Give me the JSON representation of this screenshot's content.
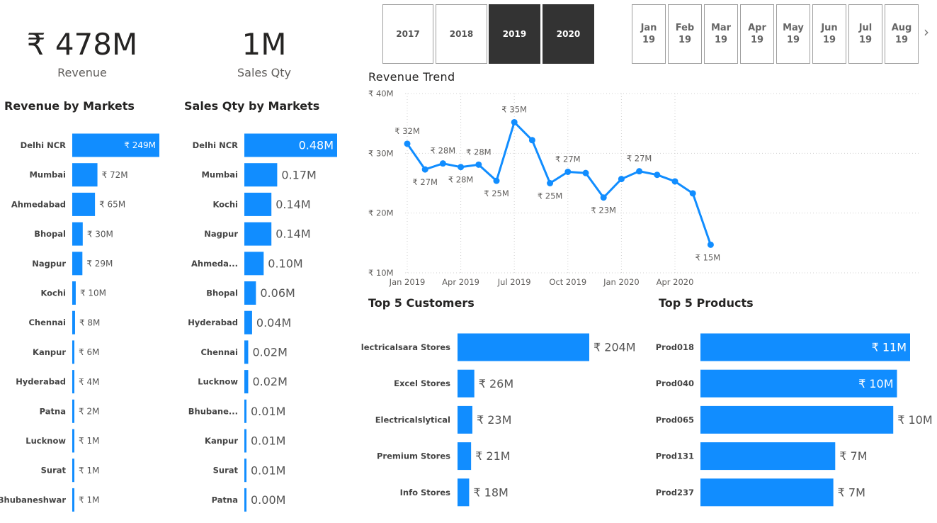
{
  "kpis": {
    "revenue": {
      "value": "₹ 478M",
      "label": "Revenue"
    },
    "sales_qty": {
      "value": "1M",
      "label": "Sales Qty"
    }
  },
  "year_slicer": [
    {
      "label": "2017",
      "selected": false
    },
    {
      "label": "2018",
      "selected": false
    },
    {
      "label": "2019",
      "selected": true
    },
    {
      "label": "2020",
      "selected": true
    }
  ],
  "month_slicer": {
    "items": [
      {
        "month": "Jan",
        "year": "19"
      },
      {
        "month": "Feb",
        "year": "19"
      },
      {
        "month": "Mar",
        "year": "19"
      },
      {
        "month": "Apr",
        "year": "19"
      },
      {
        "month": "May",
        "year": "19"
      },
      {
        "month": "Jun",
        "year": "19"
      },
      {
        "month": "Jul",
        "year": "19"
      },
      {
        "month": "Aug",
        "year": "19"
      }
    ],
    "next_glyph": "›"
  },
  "colors": {
    "bar": "#118DFF",
    "selected": "#333333",
    "grid": "#d0d0d0"
  },
  "chart_data": [
    {
      "id": "revenue_by_markets",
      "type": "bar",
      "orientation": "horizontal",
      "title": "Revenue by Markets",
      "categories": [
        "Delhi NCR",
        "Mumbai",
        "Ahmedabad",
        "Bhopal",
        "Nagpur",
        "Kochi",
        "Chennai",
        "Kanpur",
        "Hyderabad",
        "Patna",
        "Lucknow",
        "Surat",
        "Bhubaneshwar"
      ],
      "values": [
        249,
        72,
        65,
        30,
        29,
        10,
        8,
        6,
        4,
        2,
        1,
        1,
        1
      ],
      "labels": [
        "₹ 249M",
        "₹ 72M",
        "₹ 65M",
        "₹ 30M",
        "₹ 29M",
        "₹ 10M",
        "₹ 8M",
        "₹ 6M",
        "₹ 4M",
        "₹ 2M",
        "₹ 1M",
        "₹ 1M",
        "₹ 1M"
      ],
      "unit": "M"
    },
    {
      "id": "sales_qty_by_markets",
      "type": "bar",
      "orientation": "horizontal",
      "title": "Sales Qty by Markets",
      "categories": [
        "Delhi NCR",
        "Mumbai",
        "Kochi",
        "Nagpur",
        "Ahmeda...",
        "Bhopal",
        "Hyderabad",
        "Chennai",
        "Lucknow",
        "Bhubane...",
        "Kanpur",
        "Surat",
        "Patna"
      ],
      "values": [
        0.48,
        0.17,
        0.14,
        0.14,
        0.1,
        0.06,
        0.04,
        0.02,
        0.02,
        0.01,
        0.01,
        0.01,
        0.0
      ],
      "labels": [
        "0.48M",
        "0.17M",
        "0.14M",
        "0.14M",
        "0.10M",
        "0.06M",
        "0.04M",
        "0.02M",
        "0.02M",
        "0.01M",
        "0.01M",
        "0.01M",
        "0.00M"
      ],
      "unit": "M"
    },
    {
      "id": "revenue_trend",
      "type": "line",
      "title": "Revenue Trend",
      "x": [
        "2019-01",
        "2019-02",
        "2019-03",
        "2019-04",
        "2019-05",
        "2019-06",
        "2019-07",
        "2019-08",
        "2019-09",
        "2019-10",
        "2019-11",
        "2019-12",
        "2020-01",
        "2020-02",
        "2020-03",
        "2020-04",
        "2020-05",
        "2020-06"
      ],
      "values": [
        31.6,
        27.3,
        28.3,
        27.7,
        28.1,
        25.4,
        35.2,
        32.2,
        25.0,
        26.9,
        26.7,
        22.6,
        25.7,
        27.0,
        26.4,
        25.3,
        23.3,
        14.7
      ],
      "point_labels": {
        "0": "₹ 32M",
        "1": "₹ 27M",
        "2": "₹ 28M",
        "3": "₹ 28M",
        "4": "₹ 28M",
        "5": "₹ 25M",
        "6": "₹ 35M",
        "8": "₹ 25M",
        "9": "₹ 27M",
        "11": "₹ 23M",
        "13": "₹ 27M",
        "17": "₹ 15M"
      },
      "ylim": [
        10,
        40
      ],
      "yticks": [
        "₹ 10M",
        "₹ 20M",
        "₹ 30M",
        "₹ 40M"
      ],
      "xticks": [
        "Jan 2019",
        "Apr 2019",
        "Jul 2019",
        "Oct 2019",
        "Jan 2020",
        "Apr 2020"
      ],
      "grid": true
    },
    {
      "id": "top5_customers",
      "type": "bar",
      "orientation": "horizontal",
      "title": "Top 5 Customers",
      "categories": [
        "Electricalsara Stores",
        "Excel Stores",
        "Electricalslytical",
        "Premium Stores",
        "Info Stores"
      ],
      "values": [
        204,
        26,
        23,
        21,
        18
      ],
      "labels": [
        "₹ 204M",
        "₹ 26M",
        "₹ 23M",
        "₹ 21M",
        "₹ 18M"
      ],
      "unit": "M"
    },
    {
      "id": "top5_products",
      "type": "bar",
      "orientation": "horizontal",
      "title": "Top 5 Products",
      "categories": [
        "Prod018",
        "Prod040",
        "Prod065",
        "Prod131",
        "Prod237"
      ],
      "values": [
        11.2,
        10.5,
        10.3,
        7.2,
        7.1
      ],
      "labels": [
        "₹ 11M",
        "₹ 10M",
        "₹ 10M",
        "₹ 7M",
        "₹ 7M"
      ],
      "unit": "M"
    }
  ]
}
